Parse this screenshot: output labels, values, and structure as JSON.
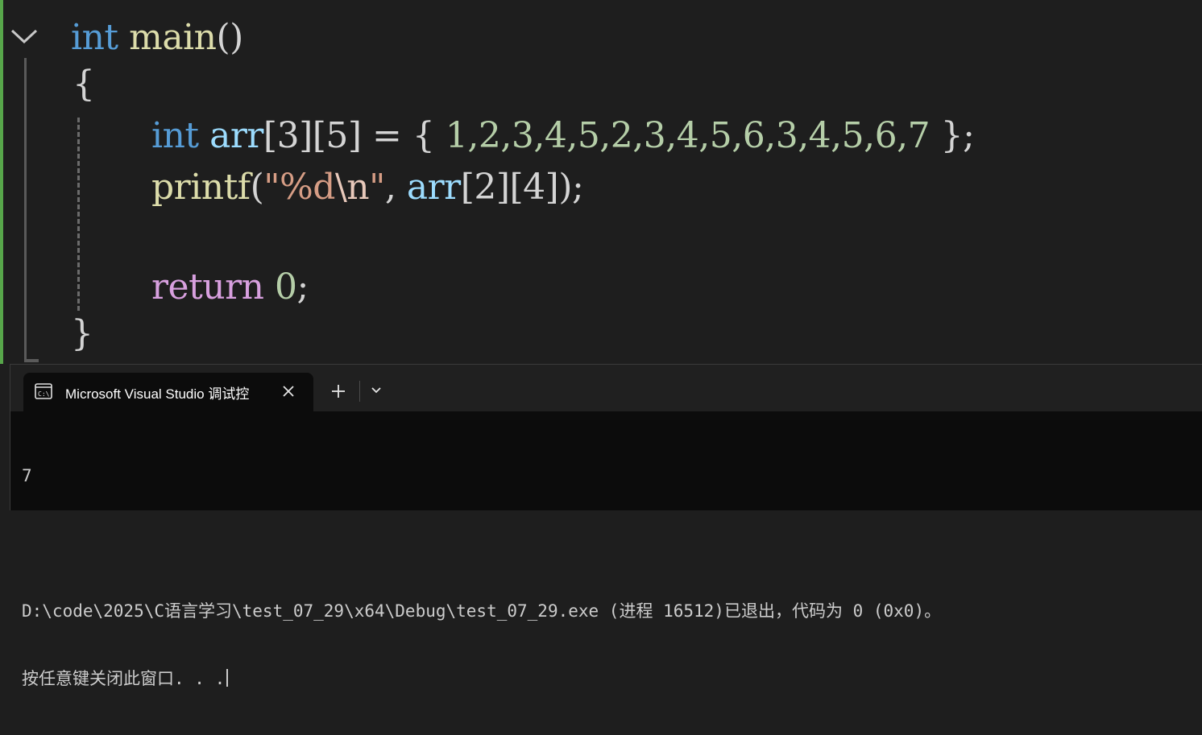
{
  "editor": {
    "line1": {
      "kw": "int",
      "fn": "main",
      "paren": "()"
    },
    "line2": {
      "brace": "{"
    },
    "line3": {
      "kw": "int",
      "var": "arr",
      "dims": "[3][5]",
      "assign": " = { ",
      "values": "1,2,3,4,5,2,3,4,5,6,3,4,5,6,7",
      "close": " };"
    },
    "line4": {
      "fn": "printf",
      "open": "(",
      "str_open": "\"%d",
      "esc": "\\n",
      "str_close": "\"",
      "comma": ", ",
      "var": "arr",
      "idx": "[2][4]",
      "close": ");"
    },
    "line6": {
      "kw": "return",
      "num": "0",
      "semi": ";"
    },
    "line7": {
      "brace": "}"
    }
  },
  "terminal": {
    "tab_title": "Microsoft Visual Studio 调试控",
    "new_tab_label": "+",
    "output_value": "7",
    "exit_message": "D:\\code\\2025\\C语言学习\\test_07_29\\x64\\Debug\\test_07_29.exe (进程 16512)已退出，代码为 0 (0x0)。",
    "prompt": "按任意键关闭此窗口. . ."
  }
}
